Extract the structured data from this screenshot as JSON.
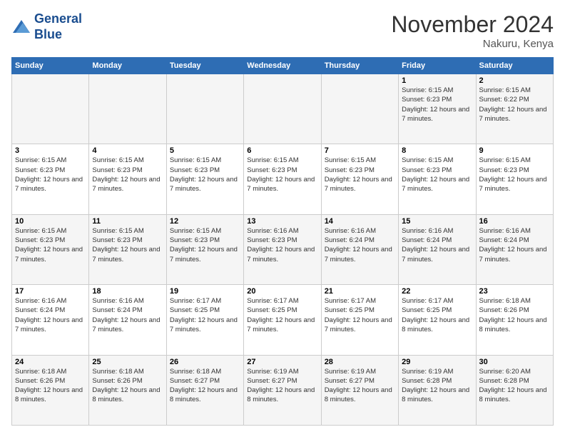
{
  "logo": {
    "line1": "General",
    "line2": "Blue"
  },
  "title": "November 2024",
  "location": "Nakuru, Kenya",
  "weekdays": [
    "Sunday",
    "Monday",
    "Tuesday",
    "Wednesday",
    "Thursday",
    "Friday",
    "Saturday"
  ],
  "weeks": [
    [
      {
        "day": "",
        "info": ""
      },
      {
        "day": "",
        "info": ""
      },
      {
        "day": "",
        "info": ""
      },
      {
        "day": "",
        "info": ""
      },
      {
        "day": "",
        "info": ""
      },
      {
        "day": "1",
        "info": "Sunrise: 6:15 AM\nSunset: 6:23 PM\nDaylight: 12 hours and 7 minutes."
      },
      {
        "day": "2",
        "info": "Sunrise: 6:15 AM\nSunset: 6:22 PM\nDaylight: 12 hours and 7 minutes."
      }
    ],
    [
      {
        "day": "3",
        "info": "Sunrise: 6:15 AM\nSunset: 6:23 PM\nDaylight: 12 hours and 7 minutes."
      },
      {
        "day": "4",
        "info": "Sunrise: 6:15 AM\nSunset: 6:23 PM\nDaylight: 12 hours and 7 minutes."
      },
      {
        "day": "5",
        "info": "Sunrise: 6:15 AM\nSunset: 6:23 PM\nDaylight: 12 hours and 7 minutes."
      },
      {
        "day": "6",
        "info": "Sunrise: 6:15 AM\nSunset: 6:23 PM\nDaylight: 12 hours and 7 minutes."
      },
      {
        "day": "7",
        "info": "Sunrise: 6:15 AM\nSunset: 6:23 PM\nDaylight: 12 hours and 7 minutes."
      },
      {
        "day": "8",
        "info": "Sunrise: 6:15 AM\nSunset: 6:23 PM\nDaylight: 12 hours and 7 minutes."
      },
      {
        "day": "9",
        "info": "Sunrise: 6:15 AM\nSunset: 6:23 PM\nDaylight: 12 hours and 7 minutes."
      }
    ],
    [
      {
        "day": "10",
        "info": "Sunrise: 6:15 AM\nSunset: 6:23 PM\nDaylight: 12 hours and 7 minutes."
      },
      {
        "day": "11",
        "info": "Sunrise: 6:15 AM\nSunset: 6:23 PM\nDaylight: 12 hours and 7 minutes."
      },
      {
        "day": "12",
        "info": "Sunrise: 6:15 AM\nSunset: 6:23 PM\nDaylight: 12 hours and 7 minutes."
      },
      {
        "day": "13",
        "info": "Sunrise: 6:16 AM\nSunset: 6:23 PM\nDaylight: 12 hours and 7 minutes."
      },
      {
        "day": "14",
        "info": "Sunrise: 6:16 AM\nSunset: 6:24 PM\nDaylight: 12 hours and 7 minutes."
      },
      {
        "day": "15",
        "info": "Sunrise: 6:16 AM\nSunset: 6:24 PM\nDaylight: 12 hours and 7 minutes."
      },
      {
        "day": "16",
        "info": "Sunrise: 6:16 AM\nSunset: 6:24 PM\nDaylight: 12 hours and 7 minutes."
      }
    ],
    [
      {
        "day": "17",
        "info": "Sunrise: 6:16 AM\nSunset: 6:24 PM\nDaylight: 12 hours and 7 minutes."
      },
      {
        "day": "18",
        "info": "Sunrise: 6:16 AM\nSunset: 6:24 PM\nDaylight: 12 hours and 7 minutes."
      },
      {
        "day": "19",
        "info": "Sunrise: 6:17 AM\nSunset: 6:25 PM\nDaylight: 12 hours and 7 minutes."
      },
      {
        "day": "20",
        "info": "Sunrise: 6:17 AM\nSunset: 6:25 PM\nDaylight: 12 hours and 7 minutes."
      },
      {
        "day": "21",
        "info": "Sunrise: 6:17 AM\nSunset: 6:25 PM\nDaylight: 12 hours and 7 minutes."
      },
      {
        "day": "22",
        "info": "Sunrise: 6:17 AM\nSunset: 6:25 PM\nDaylight: 12 hours and 8 minutes."
      },
      {
        "day": "23",
        "info": "Sunrise: 6:18 AM\nSunset: 6:26 PM\nDaylight: 12 hours and 8 minutes."
      }
    ],
    [
      {
        "day": "24",
        "info": "Sunrise: 6:18 AM\nSunset: 6:26 PM\nDaylight: 12 hours and 8 minutes."
      },
      {
        "day": "25",
        "info": "Sunrise: 6:18 AM\nSunset: 6:26 PM\nDaylight: 12 hours and 8 minutes."
      },
      {
        "day": "26",
        "info": "Sunrise: 6:18 AM\nSunset: 6:27 PM\nDaylight: 12 hours and 8 minutes."
      },
      {
        "day": "27",
        "info": "Sunrise: 6:19 AM\nSunset: 6:27 PM\nDaylight: 12 hours and 8 minutes."
      },
      {
        "day": "28",
        "info": "Sunrise: 6:19 AM\nSunset: 6:27 PM\nDaylight: 12 hours and 8 minutes."
      },
      {
        "day": "29",
        "info": "Sunrise: 6:19 AM\nSunset: 6:28 PM\nDaylight: 12 hours and 8 minutes."
      },
      {
        "day": "30",
        "info": "Sunrise: 6:20 AM\nSunset: 6:28 PM\nDaylight: 12 hours and 8 minutes."
      }
    ]
  ]
}
